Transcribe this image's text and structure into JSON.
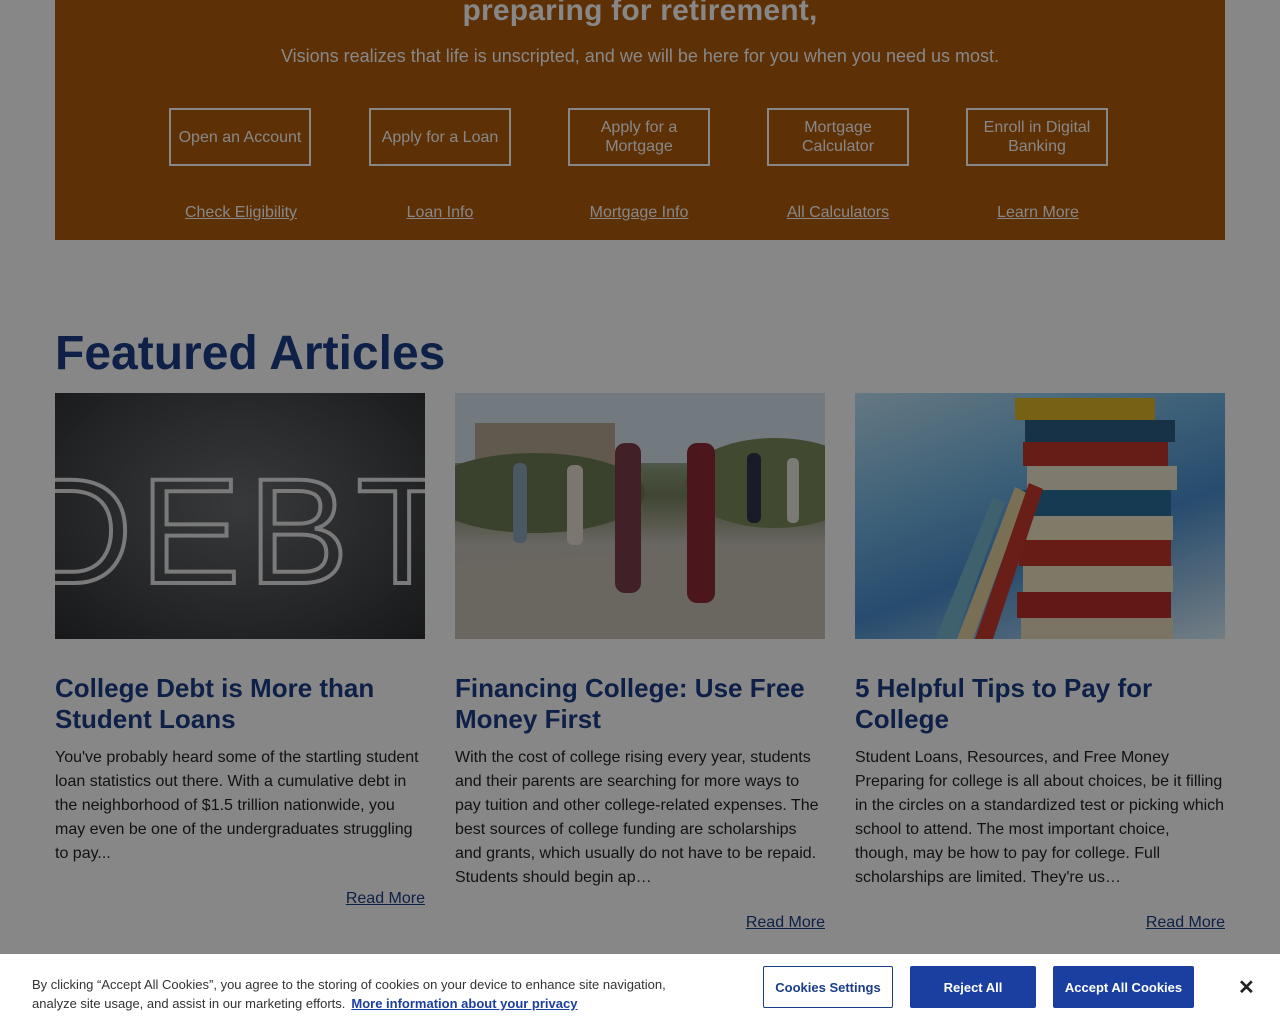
{
  "hero": {
    "title": "preparing for retirement,",
    "subtitle": "Visions realizes that life is unscripted, and we will be here for you when you need us most.",
    "buttons": [
      "Open an Account",
      "Apply for a Loan",
      "Apply for a Mortgage",
      "Mortgage Calculator",
      "Enroll in Digital Banking"
    ],
    "links": [
      "Check Eligibility",
      "Loan Info",
      "Mortgage Info",
      "All Calculators",
      "Learn More"
    ],
    "bg_color": "#b25b0b"
  },
  "featured": {
    "heading": "Featured Articles",
    "articles": [
      {
        "title": "College Debt is More than Student Loans",
        "excerpt": "You've probably heard some of the startling student loan statistics out there. With a cumulative debt in the neighborhood of $1.5 trillion nationwide, you may even be one of the undergraduates struggling to pay...",
        "read_more": "Read More",
        "image": "chalkboard-debt-image",
        "image_text": "DEBT"
      },
      {
        "title": "Financing College: Use Free Money First",
        "excerpt": "With the cost of college rising every year, students and their parents are searching for more ways to pay tuition and other college-related expenses. The best sources of college funding are scholarships and grants, which usually do not have to be repaid. Students should begin ap…",
        "read_more": "Read More",
        "image": "students-walking-image"
      },
      {
        "title": "5 Helpful Tips to Pay for College",
        "excerpt": "Student Loans, Resources, and Free Money Preparing for college is all about choices, be it filling in the circles on a standardized test or picking which school to attend. The most important choice, though, may be how to pay for college. Full scholarships are limited. They're us…",
        "read_more": "Read More",
        "image": "book-stack-image"
      }
    ],
    "heading_color": "#1b3d87"
  },
  "cookie_banner": {
    "text": "By clicking “Accept All Cookies”, you agree to the storing of cookies on your device to enhance site navigation, analyze site usage, and assist in our marketing efforts.",
    "privacy_link": "More information about your privacy",
    "settings_label": "Cookies Settings",
    "reject_label": "Reject All",
    "accept_label": "Accept All Cookies",
    "close_icon": "close-icon",
    "accent": "#1b3fa0"
  }
}
